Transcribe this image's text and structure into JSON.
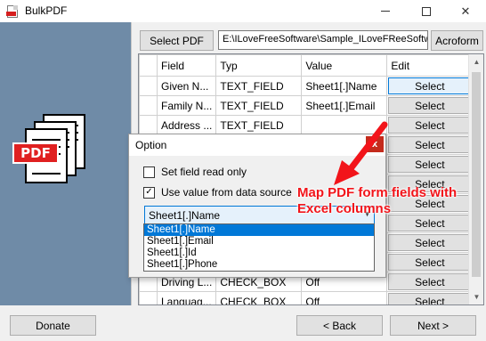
{
  "window": {
    "title": "BulkPDF",
    "icon": "pdf-app-icon"
  },
  "toolbar": {
    "select_pdf_label": "Select PDF",
    "path_value": "E:\\ILoveFreeSoftware\\Sample_ILoveFReeSoftw",
    "acroform_label": "Acroform"
  },
  "left_panel": {
    "pdf_tag": "PDF",
    "bg_color": "#6f8ba7"
  },
  "grid": {
    "columns": [
      "Field",
      "Typ",
      "Value",
      "Edit"
    ],
    "rows": [
      {
        "field": "Given N...",
        "typ": "TEXT_FIELD",
        "value": "Sheet1[.]Name",
        "edit": "Select"
      },
      {
        "field": "Family N...",
        "typ": "TEXT_FIELD",
        "value": "Sheet1[.]Email",
        "edit": "Select"
      },
      {
        "field": "Address ...",
        "typ": "TEXT_FIELD",
        "value": "",
        "edit": "Select"
      },
      {
        "field": "",
        "typ": "",
        "value": "",
        "edit": "Select"
      },
      {
        "field": "",
        "typ": "",
        "value": "",
        "edit": "Select"
      },
      {
        "field": "",
        "typ": "",
        "value": "",
        "edit": "Select"
      },
      {
        "field": "",
        "typ": "",
        "value": "",
        "edit": "Select"
      },
      {
        "field": "",
        "typ": "",
        "value": "",
        "edit": "Select"
      },
      {
        "field": "",
        "typ": "",
        "value": "",
        "edit": "Select"
      },
      {
        "field": "",
        "typ": "",
        "value": "",
        "edit": "Select"
      },
      {
        "field": "Driving L...",
        "typ": "CHECK_BOX",
        "value": "Off",
        "edit": "Select"
      },
      {
        "field": "Languag...",
        "typ": "CHECK_BOX",
        "value": "Off",
        "edit": "Select"
      }
    ]
  },
  "dialog": {
    "title": "Option",
    "close_label": "x",
    "option1_label": "Set field read only",
    "option1_checked": false,
    "option2_label": "Use value from data source",
    "option2_checked": true,
    "combo_value": "Sheet1[.]Name",
    "options": [
      "Sheet1[.]Name",
      "Sheet1[.]Email",
      "Sheet1[.]Id",
      "Sheet1[.]Phone"
    ],
    "highlighted_option": "Sheet1[.]Name"
  },
  "annotation": {
    "text": "Map PDF form fields with Excel columns",
    "color": "#f2141a"
  },
  "footer": {
    "donate_label": "Donate",
    "back_label": "< Back",
    "next_label": "Next >"
  }
}
